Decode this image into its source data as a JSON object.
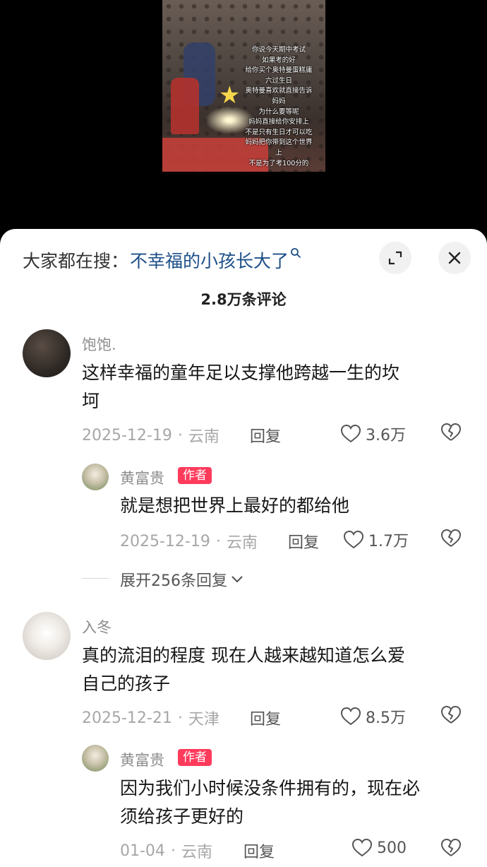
{
  "video": {
    "caption_lines": [
      "你说今天期中考试",
      "如果考的好",
      "给你买个奥特曼蛋糕庸",
      "六过生日",
      "奥特曼喜欢就直接告诉",
      "妈妈",
      "为什么要等呢",
      "妈妈直接给你安排上",
      "不是只有生日才可以吃",
      "妈妈把你带到这个世界",
      "上",
      "不是为了考100分的"
    ]
  },
  "search": {
    "prefix": "大家都在搜：",
    "term": "不幸福的小孩长大了"
  },
  "comment_count": "2.8万条评论",
  "comments": [
    {
      "username": "饱饱.",
      "text_line1": "这样幸福的童年足以支撑他跨越一生的坎",
      "text_line2": "坷",
      "date": "2025-12-19",
      "location": "云南",
      "reply_label": "回复",
      "likes": "3.6万",
      "reply": {
        "username": "黄富贵",
        "tag": "作者",
        "text": "就是想把世界上最好的都给他",
        "date": "2025-12-19",
        "location": "云南",
        "reply_label": "回复",
        "likes": "1.7万"
      },
      "expand_label": "展开256条回复"
    },
    {
      "username": "入冬",
      "text_line1": "真的流泪的程度 现在人越来越知道怎么爱",
      "text_line2": "自己的孩子",
      "date": "2025-12-21",
      "location": "天津",
      "reply_label": "回复",
      "likes": "8.5万",
      "reply": {
        "username": "黄富贵",
        "tag": "作者",
        "text_line1": "因为我们小时候没条件拥有的，现在必",
        "text_line2": "须给孩子更好的",
        "date": "01-04",
        "location": "云南",
        "reply_label": "回复",
        "likes": "500"
      }
    }
  ],
  "separator": "·",
  "colors": {
    "search_term": "#1d4f88",
    "author_tag": "#ff3b5c",
    "muted_text": "#a7a7a7"
  }
}
